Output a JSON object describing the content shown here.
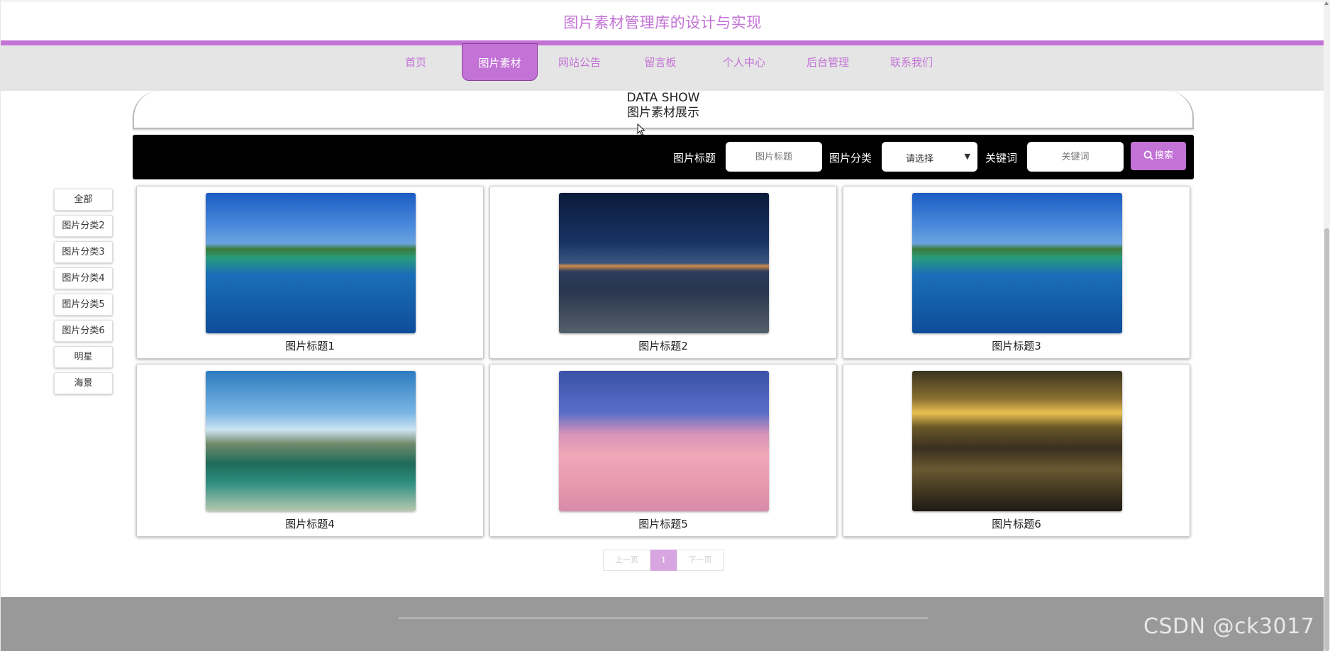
{
  "header": {
    "title": "图片素材管理库的设计与实现"
  },
  "nav": {
    "items": [
      {
        "label": "首页",
        "active": false
      },
      {
        "label": "图片素材",
        "active": true
      },
      {
        "label": "网站公告",
        "active": false
      },
      {
        "label": "留言板",
        "active": false
      },
      {
        "label": "个人中心",
        "active": false
      },
      {
        "label": "后台管理",
        "active": false
      },
      {
        "label": "联系我们",
        "active": false
      }
    ]
  },
  "section": {
    "title_en": "DATA SHOW",
    "title_cn": "图片素材展示"
  },
  "search": {
    "title_label": "图片标题",
    "title_placeholder": "图片标题",
    "category_label": "图片分类",
    "category_value": "请选择",
    "keyword_label": "关键词",
    "keyword_placeholder": "关键词",
    "button_label": "搜索"
  },
  "categories": [
    "全部",
    "图片分类2",
    "图片分类3",
    "图片分类4",
    "图片分类5",
    "图片分类6",
    "明星",
    "海景"
  ],
  "cards": [
    {
      "title": "图片标题1",
      "image": "island-lagoon"
    },
    {
      "title": "图片标题2",
      "image": "night-desert"
    },
    {
      "title": "图片标题3",
      "image": "island-lagoon"
    },
    {
      "title": "图片标题4",
      "image": "mountain-lake"
    },
    {
      "title": "图片标题5",
      "image": "pink-clouds"
    },
    {
      "title": "图片标题6",
      "image": "beach-sunset"
    }
  ],
  "pager": {
    "prev": "上一页",
    "current": "1",
    "next": "下一页"
  },
  "watermark": "CSDN @ck3017",
  "colors": {
    "accent": "#c372d6",
    "nav_bg": "#e5e5e5",
    "footer_bg": "#999999"
  }
}
